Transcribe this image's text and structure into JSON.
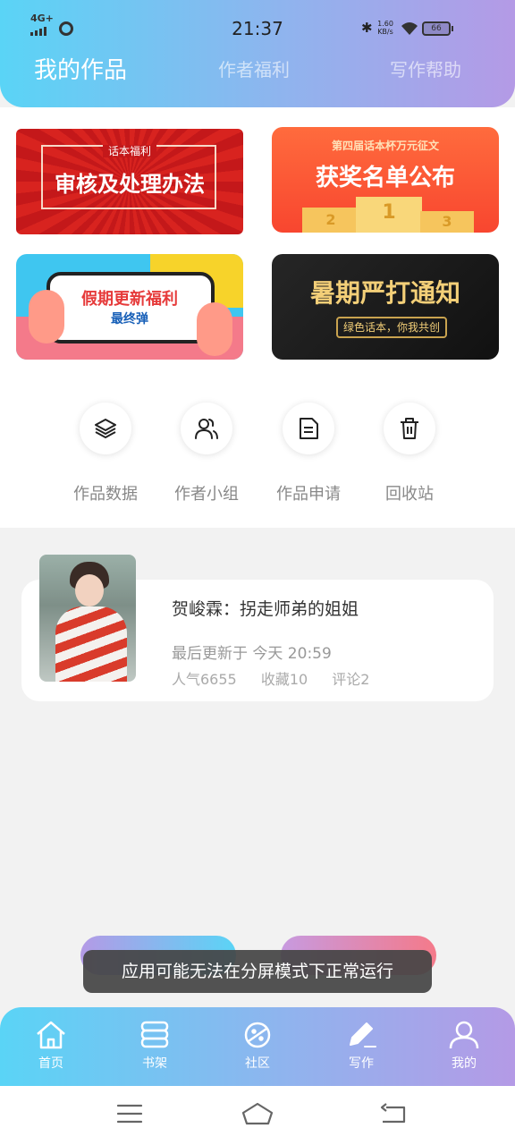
{
  "status_bar": {
    "network": "4G+",
    "time": "21:37",
    "speed_value": "1.60",
    "speed_unit": "KB/s",
    "battery": "66"
  },
  "header": {
    "tabs": [
      {
        "label": "我的作品",
        "active": true
      },
      {
        "label": "作者福利",
        "active": false
      },
      {
        "label": "写作帮助",
        "active": false
      }
    ]
  },
  "banners": [
    {
      "small": "话本福利",
      "title": "审核及处理办法"
    },
    {
      "small": "第四届话本杯万元征文",
      "title": "获奖名单公布",
      "podium": [
        "2",
        "1",
        "3"
      ]
    },
    {
      "title": "假期更新福利",
      "subtitle": "最终弹"
    },
    {
      "title": "暑期严打通知",
      "subtitle": "绿色话本，你我共创"
    }
  ],
  "quick_actions": [
    {
      "label": "作品数据",
      "icon": "layers-icon"
    },
    {
      "label": "作者小组",
      "icon": "users-icon"
    },
    {
      "label": "作品申请",
      "icon": "document-icon"
    },
    {
      "label": "回收站",
      "icon": "trash-icon"
    }
  ],
  "work": {
    "title": "贺峻霖：拐走师弟的姐姐",
    "updated": "最后更新于 今天 20:59",
    "popularity": "人气6655",
    "favorites": "收藏10",
    "comments": "评论2"
  },
  "toast": "应用可能无法在分屏模式下正常运行",
  "bottom_nav": [
    {
      "label": "首页",
      "icon": "home-icon"
    },
    {
      "label": "书架",
      "icon": "bookshelf-icon"
    },
    {
      "label": "社区",
      "icon": "planet-icon"
    },
    {
      "label": "写作",
      "icon": "pen-icon",
      "active": true
    },
    {
      "label": "我的",
      "icon": "profile-icon"
    }
  ],
  "colors": {
    "header_start": "#5ad4f6",
    "header_end": "#b49ae6",
    "toast_bg": "#444444"
  }
}
